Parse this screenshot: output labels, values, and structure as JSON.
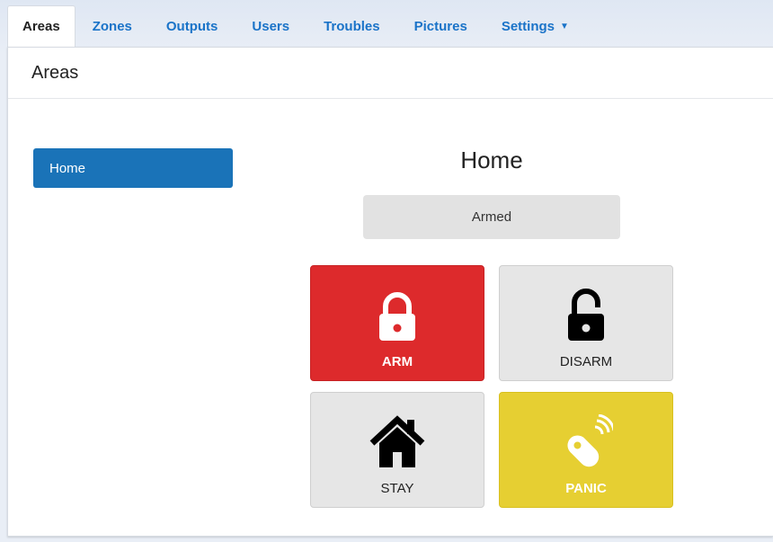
{
  "nav": {
    "tabs": [
      {
        "label": "Areas",
        "active": true
      },
      {
        "label": "Zones"
      },
      {
        "label": "Outputs"
      },
      {
        "label": "Users"
      },
      {
        "label": "Troubles"
      },
      {
        "label": "Pictures"
      },
      {
        "label": "Settings",
        "dropdown": true
      }
    ]
  },
  "panel": {
    "heading": "Areas"
  },
  "sidebar": {
    "items": [
      {
        "label": "Home",
        "selected": true
      }
    ]
  },
  "area": {
    "title": "Home",
    "status": "Armed",
    "actions": {
      "arm": {
        "label": "ARM",
        "icon": "lock-closed-icon",
        "color": "#dd2a2c"
      },
      "disarm": {
        "label": "DISARM",
        "icon": "lock-open-icon",
        "color": "#e6e6e6"
      },
      "stay": {
        "label": "STAY",
        "icon": "house-icon",
        "color": "#e6e6e6"
      },
      "panic": {
        "label": "PANIC",
        "icon": "remote-fob-icon",
        "color": "#e6cf32"
      }
    }
  },
  "colors": {
    "accent": "#1a73b8",
    "link": "#1a73c8"
  }
}
